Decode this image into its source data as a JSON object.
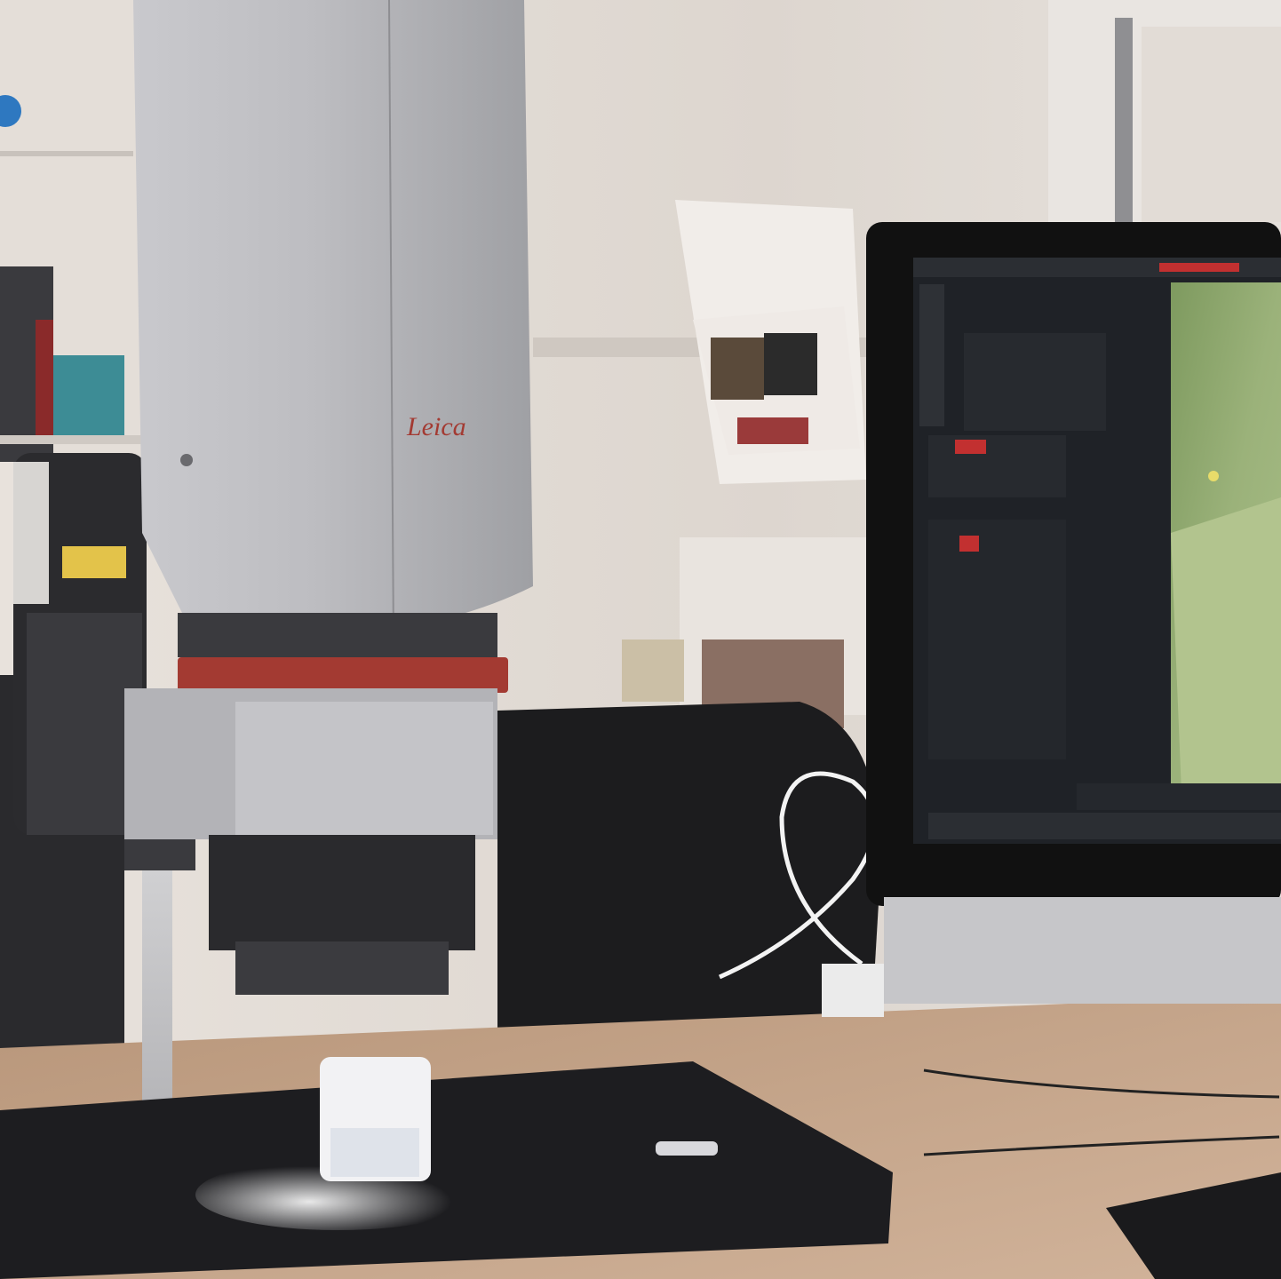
{
  "scene": {
    "description_label": "",
    "brand_logo_text": "Leica",
    "colors": {
      "wall": "#ddd6cf",
      "desk": "#c9a98c",
      "microscope_body": "#b9b9bd",
      "accent_red": "#a33a32",
      "monitor_frame": "#111111",
      "screen_panel": "#1f2227",
      "screen_image": "#8fa86d"
    }
  }
}
